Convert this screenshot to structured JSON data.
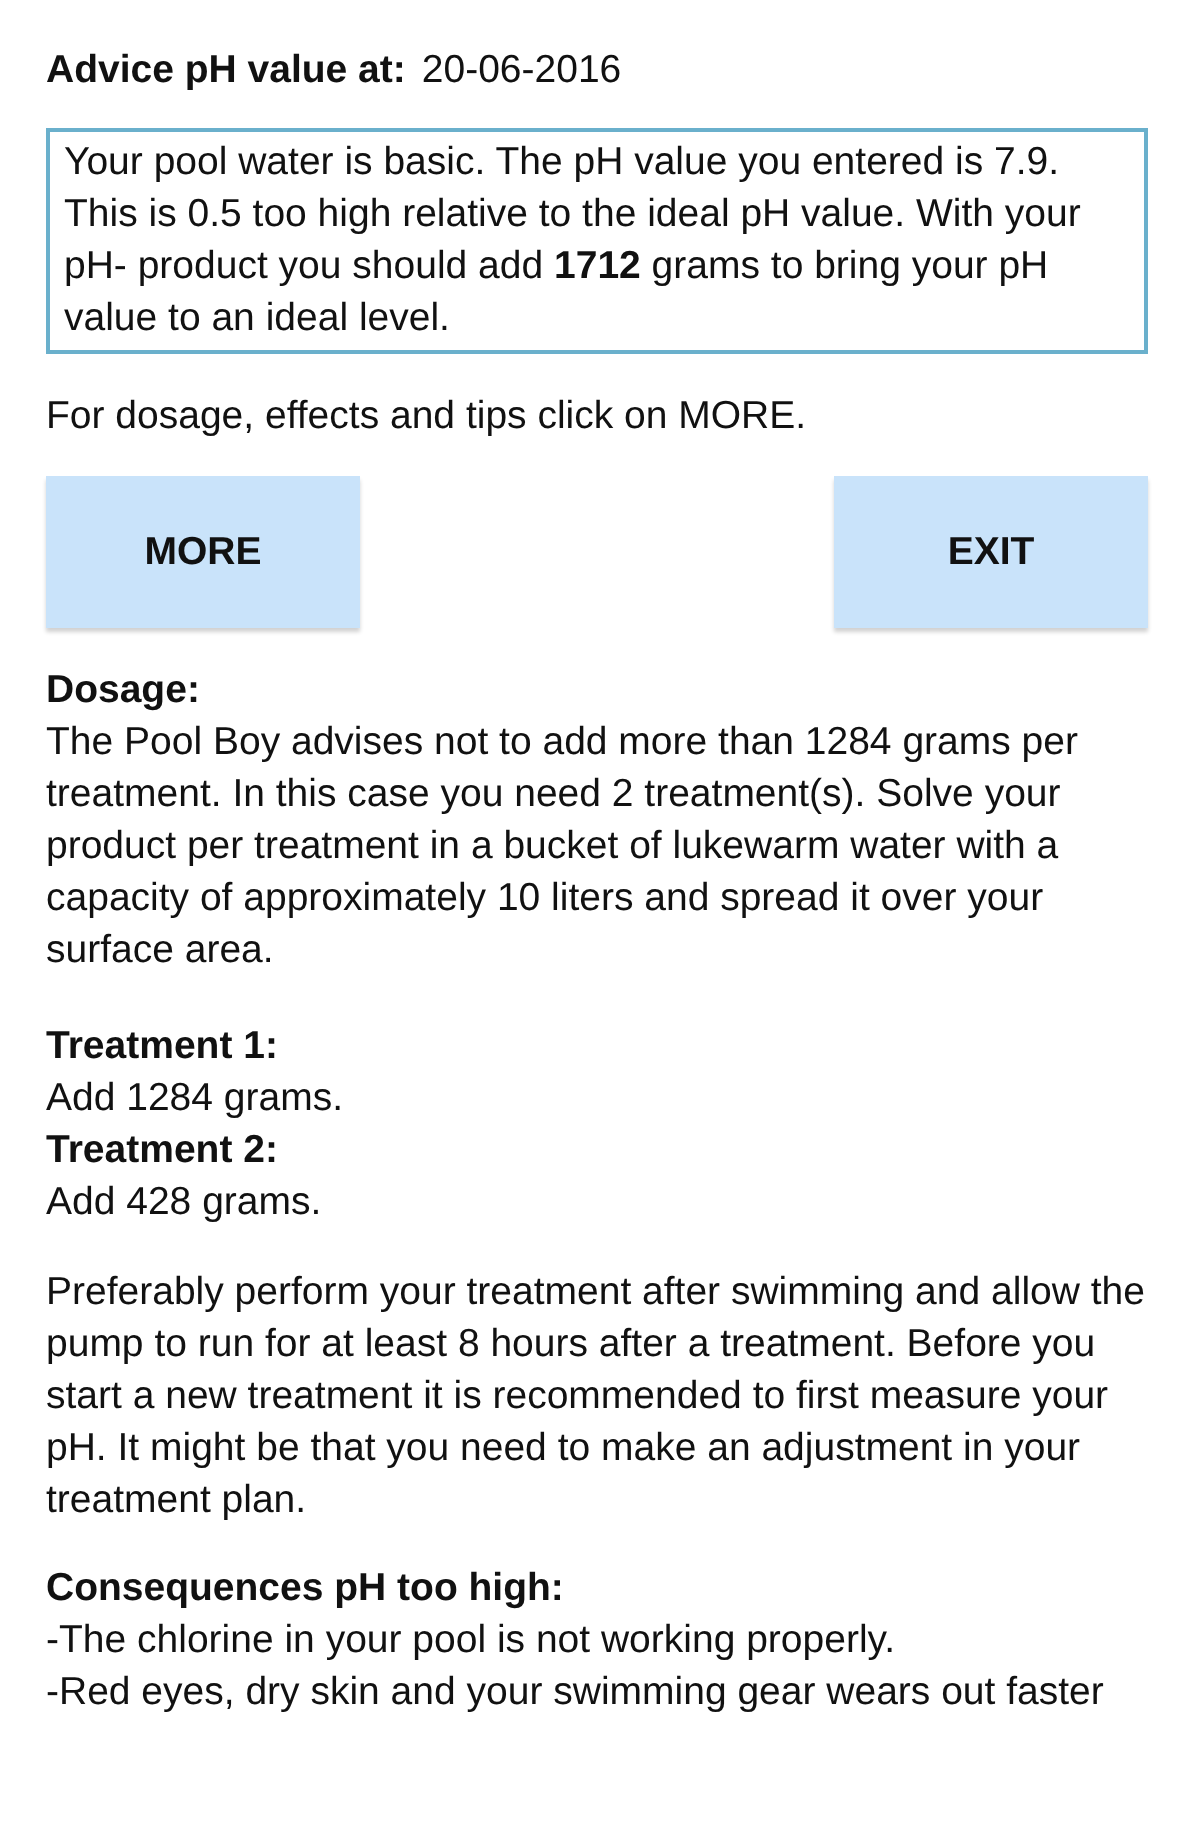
{
  "header": {
    "label": "Advice pH value at:",
    "date": "20-06-2016"
  },
  "message": "Your pool water is basic. The pH value you entered is 7.9. This is 0.5 too high relative to the ideal pH value. With your pH- product you should add **1712** grams to bring your pH value to an ideal level.",
  "hint": "For dosage, effects and tips click on MORE.",
  "buttons": [
    {
      "label": "MORE"
    },
    {
      "label": "EXIT"
    }
  ],
  "dosage": {
    "heading": "Dosage:",
    "text": "The Pool Boy advises not to add more than 1284 grams per treatment. In this case you need 2 treatment(s). Solve your product per treatment in a bucket of lukewarm water with a capacity of approximately 10 liters and spread it over your surface area."
  },
  "treatments": [
    {
      "heading": "Treatment 1:",
      "text": "Add 1284 grams."
    },
    {
      "heading": "Treatment 2:",
      "text": "Add 428 grams."
    }
  ],
  "advice": "Preferably perform your treatment after swimming and allow the pump to run for at least 8 hours after a treatment. Before you start a new treatment it is recommended to first measure your pH. It might be that you need to make an adjustment in your treatment plan.",
  "consequences": {
    "heading": "Consequences pH too high:",
    "items": [
      "-The chlorine in your pool is not working properly.",
      "-Red eyes, dry skin and your swimming gear wears out faster"
    ]
  }
}
